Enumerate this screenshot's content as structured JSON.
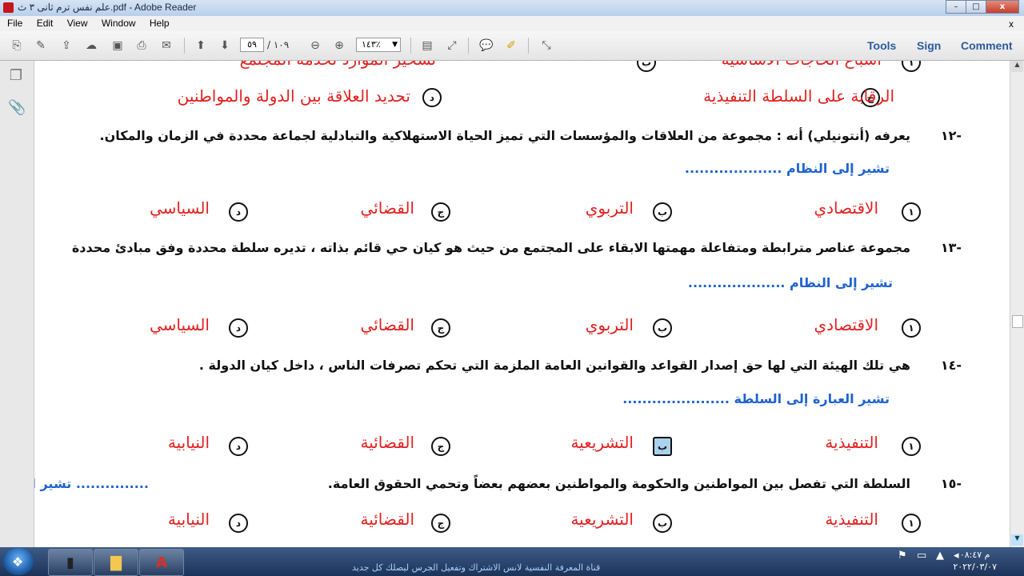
{
  "window": {
    "title": "علم نفس ترم ثانى ٣ ث.pdf - Adobe Reader",
    "min": "–",
    "max": "□",
    "close": "x"
  },
  "menu": {
    "items": [
      "File",
      "Edit",
      "View",
      "Window",
      "Help"
    ],
    "close": "x"
  },
  "toolbar": {
    "page_current": "٥٩",
    "page_total": "/ ١٠٩",
    "zoom": "١٤٣٪",
    "tools": "Tools",
    "sign": "Sign",
    "comment": "Comment"
  },
  "doc": {
    "top_clip_left": "تسخير الموارد لخدمة المجتمع",
    "top_clip_right": "اشباع الحاجات الأساسية",
    "row0": {
      "c_text": "الرقابة على السلطة التنفيذية",
      "c_letter": "ج",
      "d_text": "تحديد العلاقة بين الدولة والمواطنين",
      "d_letter": "د"
    },
    "questions": [
      {
        "num": "-١٢",
        "text": "يعرفه (أنتونيلي) أنه : مجموعة من العلاقات والمؤسسات التي تميز الحياة الاستهلاكية والتبادلية لجماعة محددة في الزمان والمكان.",
        "hint": "تشير إلى النظام ....................",
        "options": [
          {
            "letter": "١",
            "text": "الاقتصادي"
          },
          {
            "letter": "ب",
            "text": "التربوي"
          },
          {
            "letter": "ج",
            "text": "القضائي"
          },
          {
            "letter": "د",
            "text": "السياسي"
          }
        ]
      },
      {
        "num": "-١٣",
        "text": "مجموعة عناصر مترابطة ومتفاعلة مهمتها الابقاء على المجتمع من حيث هو كيان حي قائم بذاته ، تديره سلطة محددة وفق مبادئ محددة",
        "hint": "تشير إلى النظام ....................",
        "options": [
          {
            "letter": "١",
            "text": "الاقتصادي"
          },
          {
            "letter": "ب",
            "text": "التربوي"
          },
          {
            "letter": "ج",
            "text": "القضائي"
          },
          {
            "letter": "د",
            "text": "السياسي"
          }
        ]
      },
      {
        "num": "-١٤",
        "text": "هي تلك الهيئة التي لها حق إصدار القواعد والقوانين العامة الملزمة التي تحكم تصرفات الناس ، داخل كيان الدولة .",
        "hint": "تشير العبارة إلى السلطة ......................",
        "options": [
          {
            "letter": "١",
            "text": "التنفيذية"
          },
          {
            "letter": "ب",
            "text": "التشريعية"
          },
          {
            "letter": "ج",
            "text": "القضائية"
          },
          {
            "letter": "د",
            "text": "النيابية"
          }
        ]
      },
      {
        "num": "-١٥",
        "text": "السلطة التي تفصل بين المواطنين والحكومة والمواطنين بعضهم بعضاً وتحمي الحقوق العامة.",
        "hint": "تشير العبارة إلى السلطة ...............",
        "options": [
          {
            "letter": "١",
            "text": "التنفيذية"
          },
          {
            "letter": "ب",
            "text": "التشريعية"
          },
          {
            "letter": "ج",
            "text": "القضائية"
          },
          {
            "letter": "د",
            "text": "النيابية"
          }
        ]
      }
    ]
  },
  "taskbar": {
    "ticker": "قناة المعرفة النفسية لانس الاشتراك وتفعيل الجرس ليصلك كل جديد",
    "time": "م ٠٨:٤٧",
    "date": "٢٠٢٢/٠٣/٠٧"
  },
  "colors": {
    "answer_red": "#e32020",
    "hint_blue": "#1e63d0",
    "selected_bg": "#a9d2ec"
  }
}
